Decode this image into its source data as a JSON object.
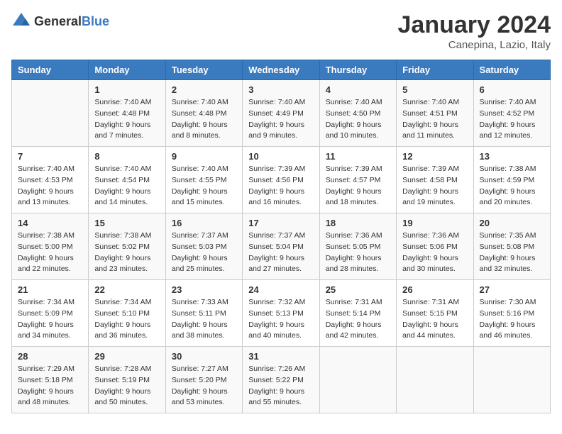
{
  "header": {
    "logo_general": "General",
    "logo_blue": "Blue",
    "title": "January 2024",
    "subtitle": "Canepina, Lazio, Italy"
  },
  "days_of_week": [
    "Sunday",
    "Monday",
    "Tuesday",
    "Wednesday",
    "Thursday",
    "Friday",
    "Saturday"
  ],
  "weeks": [
    [
      {
        "day": "",
        "info": ""
      },
      {
        "day": "1",
        "info": "Sunrise: 7:40 AM\nSunset: 4:48 PM\nDaylight: 9 hours\nand 7 minutes."
      },
      {
        "day": "2",
        "info": "Sunrise: 7:40 AM\nSunset: 4:48 PM\nDaylight: 9 hours\nand 8 minutes."
      },
      {
        "day": "3",
        "info": "Sunrise: 7:40 AM\nSunset: 4:49 PM\nDaylight: 9 hours\nand 9 minutes."
      },
      {
        "day": "4",
        "info": "Sunrise: 7:40 AM\nSunset: 4:50 PM\nDaylight: 9 hours\nand 10 minutes."
      },
      {
        "day": "5",
        "info": "Sunrise: 7:40 AM\nSunset: 4:51 PM\nDaylight: 9 hours\nand 11 minutes."
      },
      {
        "day": "6",
        "info": "Sunrise: 7:40 AM\nSunset: 4:52 PM\nDaylight: 9 hours\nand 12 minutes."
      }
    ],
    [
      {
        "day": "7",
        "info": "Sunrise: 7:40 AM\nSunset: 4:53 PM\nDaylight: 9 hours\nand 13 minutes."
      },
      {
        "day": "8",
        "info": "Sunrise: 7:40 AM\nSunset: 4:54 PM\nDaylight: 9 hours\nand 14 minutes."
      },
      {
        "day": "9",
        "info": "Sunrise: 7:40 AM\nSunset: 4:55 PM\nDaylight: 9 hours\nand 15 minutes."
      },
      {
        "day": "10",
        "info": "Sunrise: 7:39 AM\nSunset: 4:56 PM\nDaylight: 9 hours\nand 16 minutes."
      },
      {
        "day": "11",
        "info": "Sunrise: 7:39 AM\nSunset: 4:57 PM\nDaylight: 9 hours\nand 18 minutes."
      },
      {
        "day": "12",
        "info": "Sunrise: 7:39 AM\nSunset: 4:58 PM\nDaylight: 9 hours\nand 19 minutes."
      },
      {
        "day": "13",
        "info": "Sunrise: 7:38 AM\nSunset: 4:59 PM\nDaylight: 9 hours\nand 20 minutes."
      }
    ],
    [
      {
        "day": "14",
        "info": "Sunrise: 7:38 AM\nSunset: 5:00 PM\nDaylight: 9 hours\nand 22 minutes."
      },
      {
        "day": "15",
        "info": "Sunrise: 7:38 AM\nSunset: 5:02 PM\nDaylight: 9 hours\nand 23 minutes."
      },
      {
        "day": "16",
        "info": "Sunrise: 7:37 AM\nSunset: 5:03 PM\nDaylight: 9 hours\nand 25 minutes."
      },
      {
        "day": "17",
        "info": "Sunrise: 7:37 AM\nSunset: 5:04 PM\nDaylight: 9 hours\nand 27 minutes."
      },
      {
        "day": "18",
        "info": "Sunrise: 7:36 AM\nSunset: 5:05 PM\nDaylight: 9 hours\nand 28 minutes."
      },
      {
        "day": "19",
        "info": "Sunrise: 7:36 AM\nSunset: 5:06 PM\nDaylight: 9 hours\nand 30 minutes."
      },
      {
        "day": "20",
        "info": "Sunrise: 7:35 AM\nSunset: 5:08 PM\nDaylight: 9 hours\nand 32 minutes."
      }
    ],
    [
      {
        "day": "21",
        "info": "Sunrise: 7:34 AM\nSunset: 5:09 PM\nDaylight: 9 hours\nand 34 minutes."
      },
      {
        "day": "22",
        "info": "Sunrise: 7:34 AM\nSunset: 5:10 PM\nDaylight: 9 hours\nand 36 minutes."
      },
      {
        "day": "23",
        "info": "Sunrise: 7:33 AM\nSunset: 5:11 PM\nDaylight: 9 hours\nand 38 minutes."
      },
      {
        "day": "24",
        "info": "Sunrise: 7:32 AM\nSunset: 5:13 PM\nDaylight: 9 hours\nand 40 minutes."
      },
      {
        "day": "25",
        "info": "Sunrise: 7:31 AM\nSunset: 5:14 PM\nDaylight: 9 hours\nand 42 minutes."
      },
      {
        "day": "26",
        "info": "Sunrise: 7:31 AM\nSunset: 5:15 PM\nDaylight: 9 hours\nand 44 minutes."
      },
      {
        "day": "27",
        "info": "Sunrise: 7:30 AM\nSunset: 5:16 PM\nDaylight: 9 hours\nand 46 minutes."
      }
    ],
    [
      {
        "day": "28",
        "info": "Sunrise: 7:29 AM\nSunset: 5:18 PM\nDaylight: 9 hours\nand 48 minutes."
      },
      {
        "day": "29",
        "info": "Sunrise: 7:28 AM\nSunset: 5:19 PM\nDaylight: 9 hours\nand 50 minutes."
      },
      {
        "day": "30",
        "info": "Sunrise: 7:27 AM\nSunset: 5:20 PM\nDaylight: 9 hours\nand 53 minutes."
      },
      {
        "day": "31",
        "info": "Sunrise: 7:26 AM\nSunset: 5:22 PM\nDaylight: 9 hours\nand 55 minutes."
      },
      {
        "day": "",
        "info": ""
      },
      {
        "day": "",
        "info": ""
      },
      {
        "day": "",
        "info": ""
      }
    ]
  ]
}
